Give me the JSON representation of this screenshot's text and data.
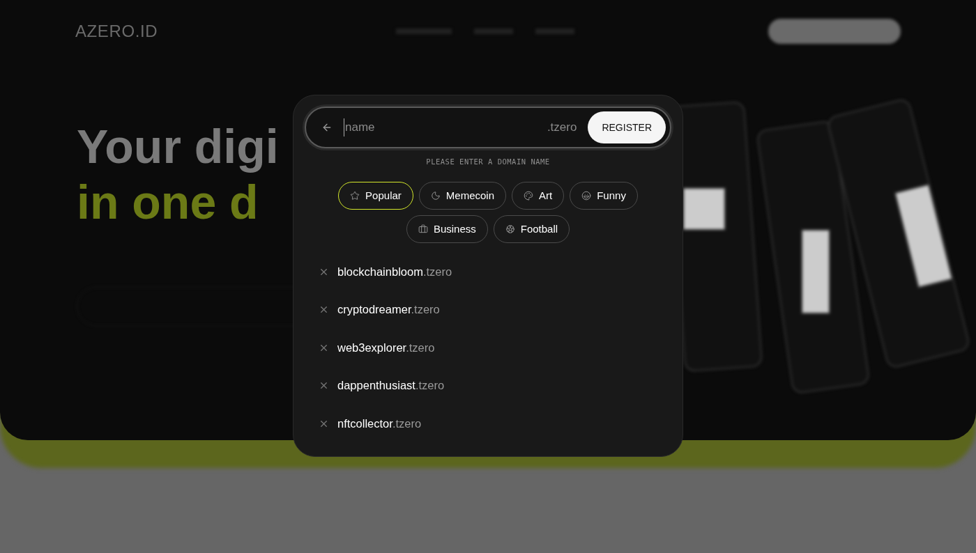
{
  "header": {
    "logo": "AZERO.ID"
  },
  "hero": {
    "line_1": "Your digi",
    "line_2": "in one d"
  },
  "modal": {
    "search": {
      "placeholder": "name",
      "suffix": ".tzero",
      "button": "REGISTER"
    },
    "hint": "PLEASE ENTER A DOMAIN NAME",
    "categories": [
      {
        "label": "Popular",
        "kind": "star",
        "selected": true
      },
      {
        "label": "Memecoin",
        "kind": "moon",
        "selected": false
      },
      {
        "label": "Art",
        "kind": "palette",
        "selected": false
      },
      {
        "label": "Funny",
        "kind": "laugh",
        "selected": false
      },
      {
        "label": "Business",
        "kind": "briefcase",
        "selected": false
      },
      {
        "label": "Football",
        "kind": "football",
        "selected": false
      }
    ],
    "suggestions": [
      {
        "name": "blockchainbloom",
        "tld": ".tzero"
      },
      {
        "name": "cryptodreamer",
        "tld": ".tzero"
      },
      {
        "name": "web3explorer",
        "tld": ".tzero"
      },
      {
        "name": "dappenthusiast",
        "tld": ".tzero"
      },
      {
        "name": "nftcollector",
        "tld": ".tzero"
      }
    ]
  }
}
